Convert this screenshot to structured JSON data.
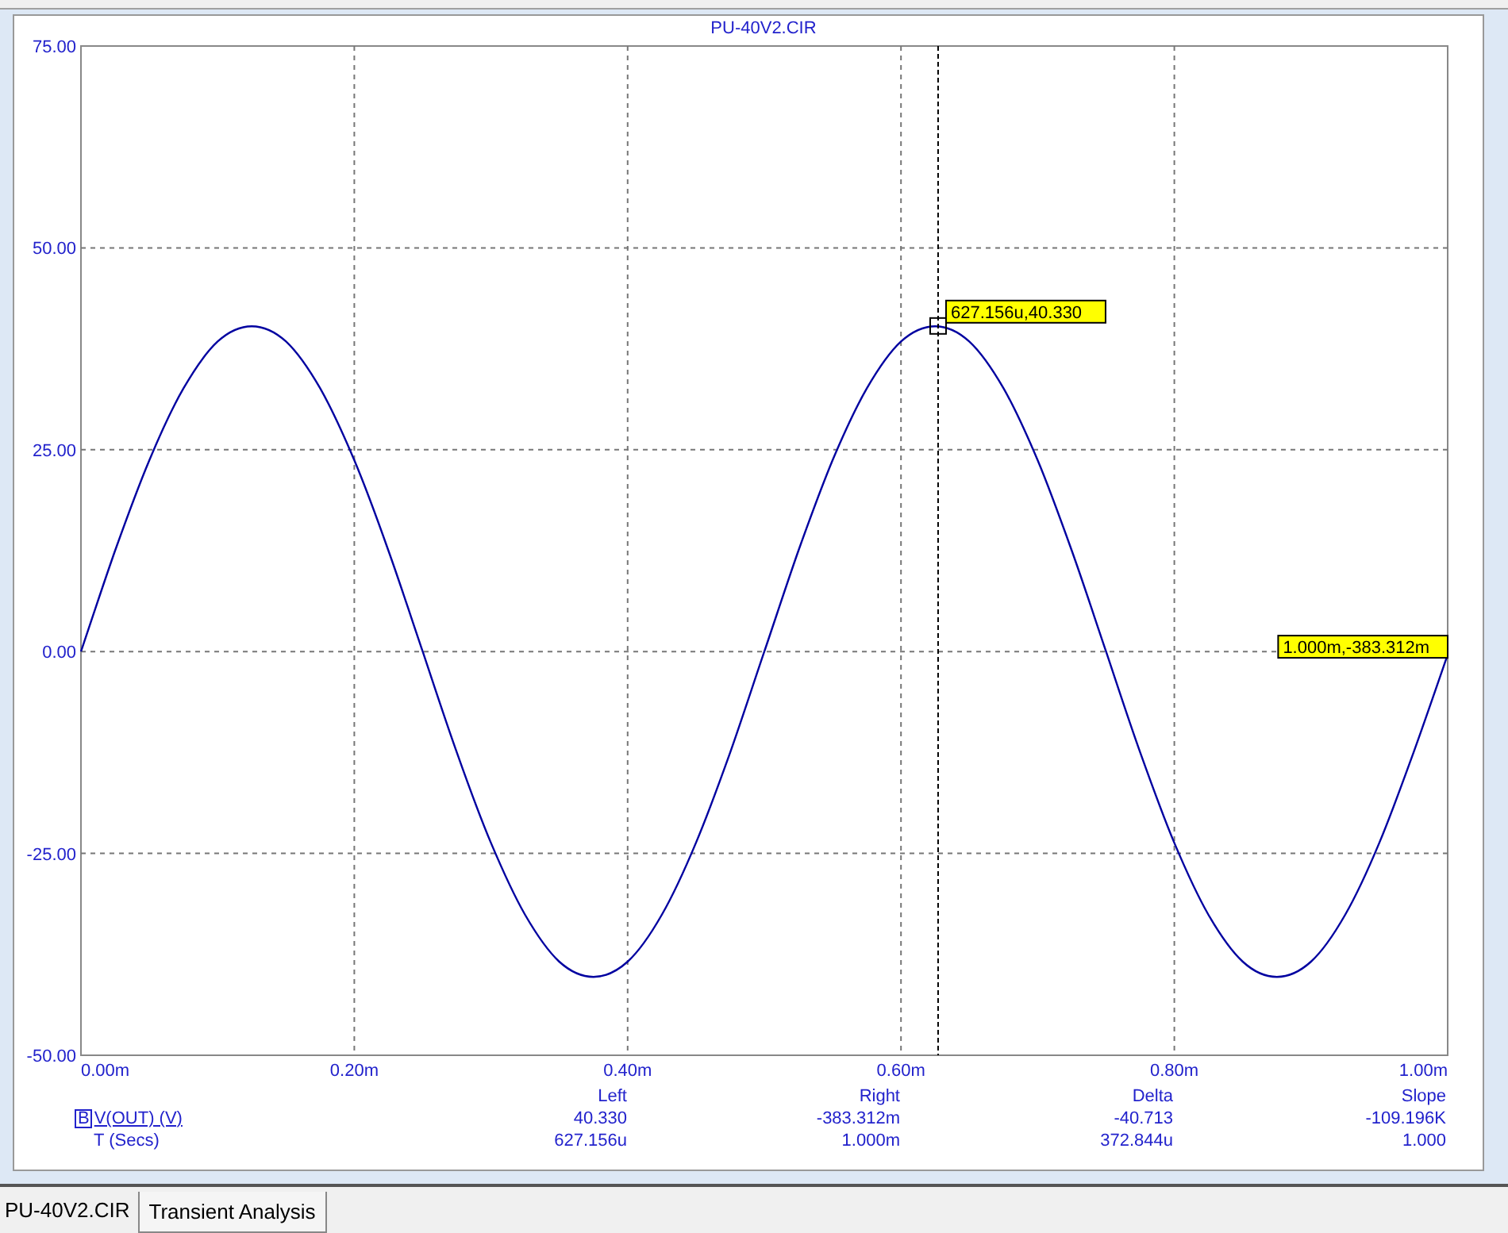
{
  "chart": {
    "title": "PU-40V2.CIR",
    "chart_data": {
      "type": "line",
      "x": [
        0,
        0.025,
        0.05,
        0.075,
        0.1,
        0.125,
        0.15,
        0.175,
        0.2,
        0.225,
        0.25,
        0.275,
        0.3,
        0.325,
        0.35,
        0.375,
        0.4,
        0.425,
        0.45,
        0.475,
        0.5,
        0.525,
        0.55,
        0.575,
        0.6,
        0.625,
        0.65,
        0.675,
        0.7,
        0.725,
        0.75,
        0.775,
        0.8,
        0.825,
        0.85,
        0.875,
        0.9,
        0.925,
        0.95,
        0.975,
        1.0
      ],
      "series": [
        {
          "name": "V(OUT) (V)",
          "color": "#0000a0",
          "values": [
            0,
            12.5,
            23.7,
            32.6,
            38.4,
            40.3,
            38.4,
            32.6,
            23.7,
            12.5,
            0,
            -12.5,
            -23.7,
            -32.6,
            -38.4,
            -40.3,
            -38.4,
            -32.6,
            -23.7,
            -12.5,
            0,
            12.5,
            23.7,
            32.6,
            38.4,
            40.3,
            38.4,
            32.6,
            23.7,
            12.5,
            0,
            -12.5,
            -23.7,
            -32.6,
            -38.4,
            -40.3,
            -38.4,
            -32.6,
            -23.7,
            -12.5,
            -0.4
          ]
        }
      ],
      "grid": true,
      "ref_lines": [
        {
          "axis": "x",
          "value": 0.627156
        }
      ],
      "xlim": [
        0,
        1
      ],
      "ylim": [
        -50,
        75
      ],
      "xticks": [
        {
          "value": 0,
          "label": "0.00m"
        },
        {
          "value": 0.2,
          "label": "0.20m"
        },
        {
          "value": 0.4,
          "label": "0.40m"
        },
        {
          "value": 0.6,
          "label": "0.60m"
        },
        {
          "value": 0.8,
          "label": "0.80m"
        },
        {
          "value": 1.0,
          "label": "1.00m"
        }
      ],
      "yticks": [
        {
          "value": 75,
          "label": "75.00"
        },
        {
          "value": 50,
          "label": "50.00"
        },
        {
          "value": 25,
          "label": "25.00"
        },
        {
          "value": 0,
          "label": "0.00"
        },
        {
          "value": -25,
          "label": "-25.00"
        },
        {
          "value": -50,
          "label": "-50.00"
        }
      ],
      "annotations": [
        {
          "x": 0.627156,
          "y": 40.33,
          "text": "627.156u,40.330"
        },
        {
          "x": 1.0,
          "y": -0.383,
          "text": "1.000m,-383.312m"
        }
      ]
    }
  },
  "readout": {
    "columns": [
      "Left",
      "Right",
      "Delta",
      "Slope"
    ],
    "rows": [
      {
        "marker": "B",
        "values": [
          "40.330",
          "-383.312m",
          "-40.713",
          "-109.196K"
        ]
      },
      {
        "label": "T (Secs)",
        "values": [
          "627.156u",
          "1.000m",
          "372.844u",
          "1.000"
        ]
      }
    ]
  },
  "tabs": [
    {
      "label": "PU-40V2.CIR",
      "selected": false
    },
    {
      "label": "Transient Analysis",
      "selected": true
    }
  ]
}
